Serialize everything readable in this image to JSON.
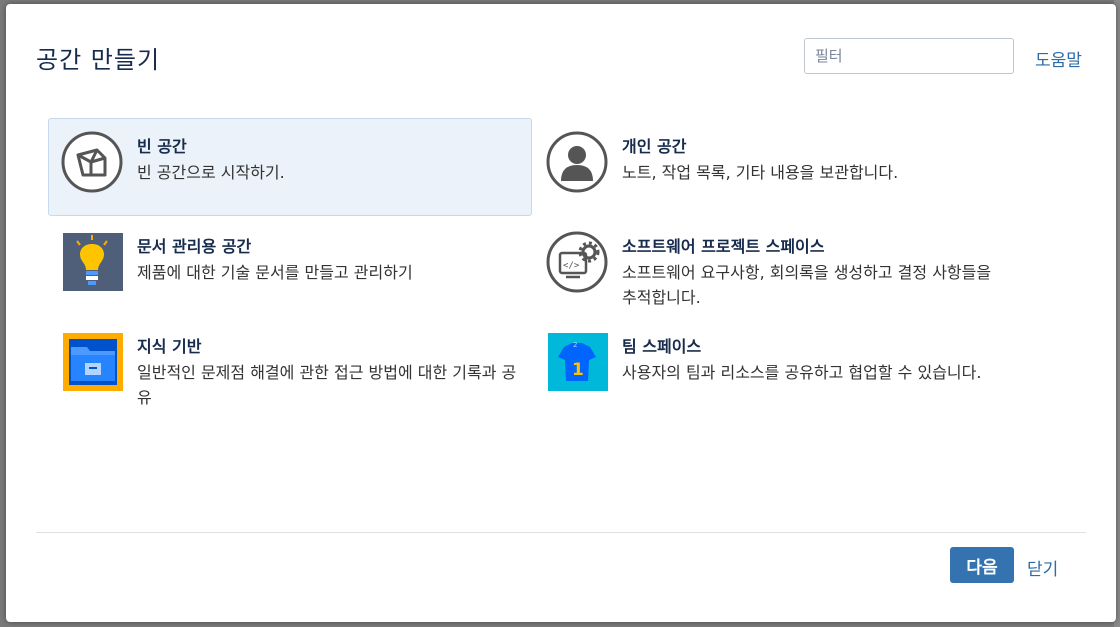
{
  "dialog": {
    "title": "공간 만들기",
    "filter_placeholder": "필터",
    "help_label": "도움말",
    "next_label": "다음",
    "close_label": "닫기"
  },
  "items": [
    {
      "name": "빈 공간",
      "desc": "빈 공간으로 시작하기.",
      "icon": "blank-space-icon",
      "selected": true
    },
    {
      "name": "개인 공간",
      "desc": "노트, 작업 목록, 기타 내용을 보관합니다.",
      "icon": "personal-space-icon",
      "selected": false
    },
    {
      "name": "문서 관리용 공간",
      "desc": "제품에 대한 기술 문서를 만들고 관리하기",
      "icon": "lightbulb-icon",
      "selected": false
    },
    {
      "name": "소프트웨어 프로젝트 스페이스",
      "desc": "소프트웨어 요구사항, 회의록을 생성하고 결정 사항들을 추적합니다.",
      "icon": "software-project-icon",
      "selected": false
    },
    {
      "name": "지식 기반",
      "desc": "일반적인 문제점 해결에 관한 접근 방법에 대한 기록과 공유",
      "icon": "knowledge-base-icon",
      "selected": false
    },
    {
      "name": "팀 스페이스",
      "desc": "사용자의 팀과 리소스를 공유하고 협업할 수 있습니다.",
      "icon": "team-space-icon",
      "selected": false
    }
  ],
  "colors": {
    "accent": "#3572b0",
    "link": "#2c6aa8",
    "selected_bg": "#ebf2f9"
  }
}
